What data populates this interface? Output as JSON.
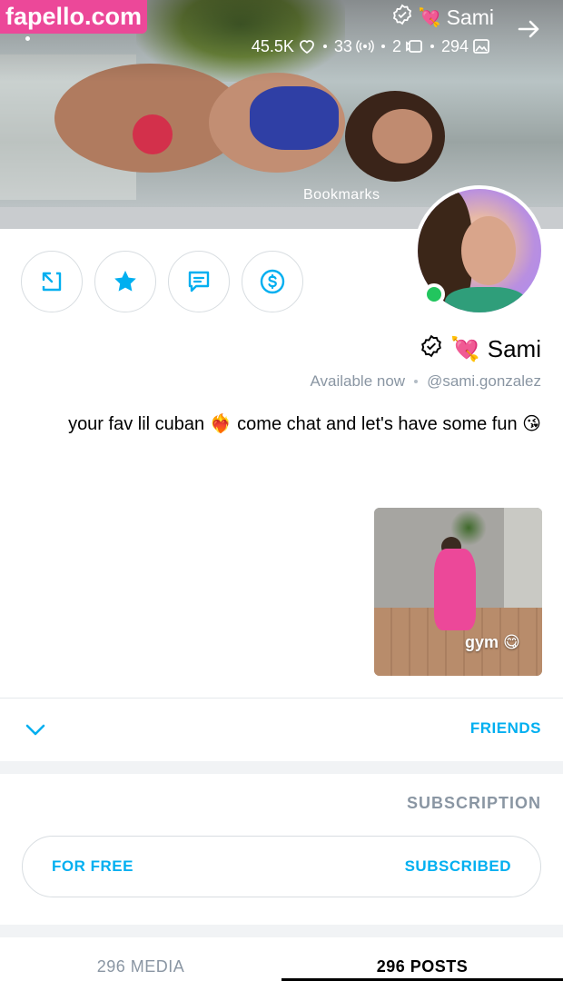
{
  "brand": {
    "label": "fapello.com"
  },
  "cover": {
    "name": "Sami",
    "emoji": "💘",
    "bookmarks_label": "Bookmarks",
    "stats": [
      {
        "icon": "image-icon",
        "value": "294"
      },
      {
        "icon": "video-icon",
        "value": "2"
      },
      {
        "icon": "stream-icon",
        "value": "33"
      },
      {
        "icon": "heart-icon",
        "value": "45.5K"
      }
    ]
  },
  "actions": [
    {
      "name": "tip-button",
      "icon": "dollar-icon"
    },
    {
      "name": "message-button",
      "icon": "chat-icon"
    },
    {
      "name": "favorite-button",
      "icon": "star-icon"
    },
    {
      "name": "share-button",
      "icon": "share-icon"
    }
  ],
  "profile": {
    "name": "Sami",
    "emoji": "💘",
    "username": "@sami.gonzalez",
    "status": "Available now",
    "bio": "your fav lil cuban ❤️‍🔥 come chat and let's have some fun 😘"
  },
  "highlight": {
    "label": "gym 😋"
  },
  "friends": {
    "label": "FRIENDS"
  },
  "subscription": {
    "title": "SUBSCRIPTION",
    "button_left": "SUBSCRIBED",
    "button_right": "FOR FREE"
  },
  "tabs": {
    "posts": "296 POSTS",
    "media": "296 MEDIA"
  },
  "colors": {
    "accent": "#00aff0",
    "brand": "#ec4899",
    "online": "#22c55e",
    "muted": "#8a96a3"
  }
}
